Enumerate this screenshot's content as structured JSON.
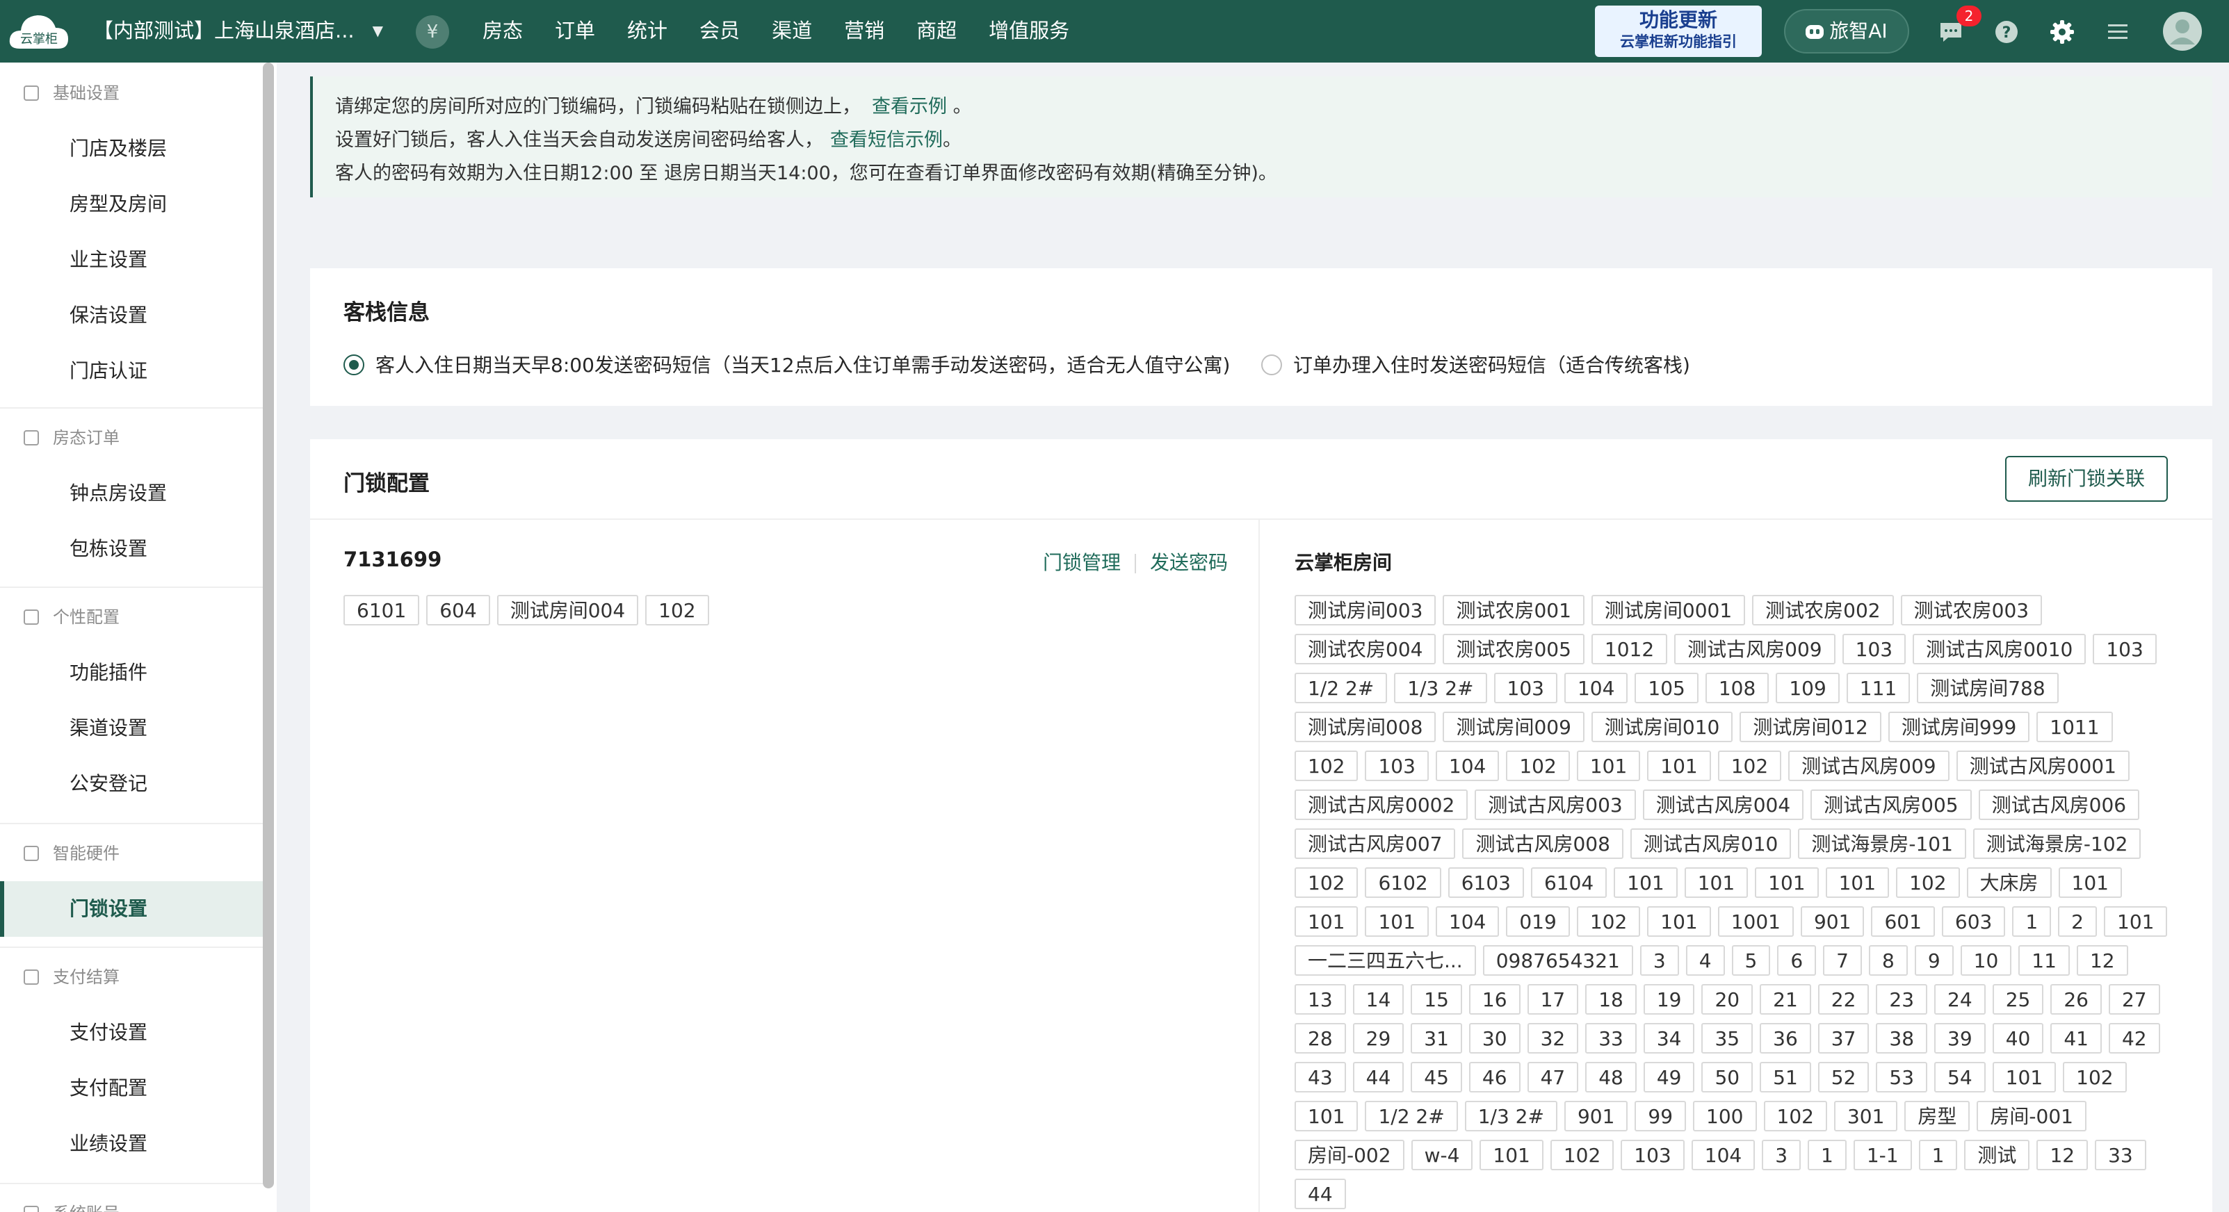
{
  "header": {
    "logo_text": "云掌柜",
    "store_name": "【内部测试】上海山泉酒店...",
    "currency_symbol": "¥",
    "nav": [
      "房态",
      "订单",
      "统计",
      "会员",
      "渠道",
      "营销",
      "商超",
      "增值服务"
    ],
    "promo_title": "功能更新",
    "promo_subtitle": "云掌柜新功能指引",
    "ai_label": "旅智AI",
    "message_badge": "2",
    "brand_color": "#1f5b4d"
  },
  "sidebar": {
    "groups": [
      {
        "title": "基础设置",
        "icon": "home-icon",
        "items": [
          "门店及楼层",
          "房型及房间",
          "业主设置",
          "保洁设置",
          "门店认证"
        ]
      },
      {
        "title": "房态订单",
        "icon": "calendar-icon",
        "items": [
          "钟点房设置",
          "包栋设置"
        ]
      },
      {
        "title": "个性配置",
        "icon": "settings-icon",
        "items": [
          "功能插件",
          "渠道设置",
          "公安登记"
        ]
      },
      {
        "title": "智能硬件",
        "icon": "device-icon",
        "items": [
          "门锁设置"
        ]
      },
      {
        "title": "支付结算",
        "icon": "payment-icon",
        "items": [
          "支付设置",
          "支付配置",
          "业绩设置"
        ]
      },
      {
        "title": "系统账号",
        "icon": "account-icon",
        "items": []
      }
    ],
    "active_item": "门锁设置"
  },
  "notice": {
    "line1": "请绑定您的房间所对应的门锁编码，门锁编码粘贴在锁侧边上，",
    "line1_link": "查看示例",
    "line1_tail": "。",
    "line2": "设置好门锁后，客人入住当天会自动发送房间密码给客人，",
    "line2_link": "查看短信示例",
    "line2_tail": "。",
    "line3": "客人的密码有效期为入住日期12:00 至 退房日期当天14:00，您可在查看订单界面修改密码有效期(精确至分钟)。"
  },
  "inn_info": {
    "title": "客栈信息",
    "option1": "客人入住日期当天早8:00发送密码短信（当天12点后入住订单需手动发送密码，适合无人值守公寓)",
    "option2": "订单办理入住时发送密码短信（适合传统客栈)",
    "selected": "option1"
  },
  "lock_config": {
    "title": "门锁配置",
    "refresh_button": "刷新门锁关联",
    "lock_id": "7131699",
    "manage_link": "门锁管理",
    "send_link": "发送密码",
    "bound_rooms": [
      "6101",
      "604",
      "测试房间004",
      "102"
    ],
    "cloud_rooms_title": "云掌柜房间",
    "cloud_rooms": [
      "测试房间003",
      "测试农房001",
      "测试房间0001",
      "测试农房002",
      "测试农房003",
      "测试农房004",
      "测试农房005",
      "1012",
      "测试古风房009",
      "103",
      "测试古风房0010",
      "103",
      "1/2 2#",
      "1/3 2#",
      "103",
      "104",
      "105",
      "108",
      "109",
      "111",
      "测试房间788",
      "测试房间008",
      "测试房间009",
      "测试房间010",
      "测试房间012",
      "测试房间999",
      "1011",
      "102",
      "103",
      "104",
      "102",
      "101",
      "101",
      "102",
      "测试古风房009",
      "测试古风房0001",
      "测试古风房0002",
      "测试古风房003",
      "测试古风房004",
      "测试古风房005",
      "测试古风房006",
      "测试古风房007",
      "测试古风房008",
      "测试古风房010",
      "测试海景房-101",
      "测试海景房-102",
      "102",
      "6102",
      "6103",
      "6104",
      "101",
      "101",
      "101",
      "101",
      "102",
      "大床房",
      "101",
      "101",
      "101",
      "104",
      "019",
      "102",
      "101",
      "1001",
      "901",
      "601",
      "603",
      "1",
      "2",
      "101",
      "一二三四五六七...",
      "0987654321",
      "3",
      "4",
      "5",
      "6",
      "7",
      "8",
      "9",
      "10",
      "11",
      "12",
      "13",
      "14",
      "15",
      "16",
      "17",
      "18",
      "19",
      "20",
      "21",
      "22",
      "23",
      "24",
      "25",
      "26",
      "27",
      "28",
      "29",
      "31",
      "30",
      "32",
      "33",
      "34",
      "35",
      "36",
      "37",
      "38",
      "39",
      "40",
      "41",
      "42",
      "43",
      "44",
      "45",
      "46",
      "47",
      "48",
      "49",
      "50",
      "51",
      "52",
      "53",
      "54",
      "101",
      "102",
      "101",
      "1/2 2#",
      "1/3 2#",
      "901",
      "99",
      "100",
      "102",
      "301",
      "房型",
      "房间-001",
      "房间-002",
      "w-4",
      "101",
      "102",
      "103",
      "104",
      "3",
      "1",
      "1-1",
      "1",
      "测试",
      "12",
      "33",
      "44"
    ]
  }
}
